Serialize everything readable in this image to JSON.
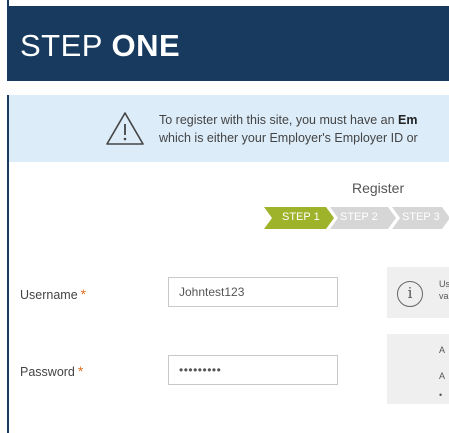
{
  "header": {
    "title_light": "STEP ",
    "title_bold": "ONE"
  },
  "banner": {
    "line1_prefix": "To register with this site, you must have an ",
    "line1_bold": "Em",
    "line2": "which is either your Employer's Employer ID or"
  },
  "register": {
    "title": "Register",
    "steps": [
      {
        "label": "STEP 1",
        "state": "active"
      },
      {
        "label": "STEP 2",
        "state": "inactive"
      },
      {
        "label": "STEP 3",
        "state": "inactive"
      }
    ],
    "active_color": "#9eb22a",
    "inactive_color": "#d6d6d6"
  },
  "form": {
    "username": {
      "label": "Username",
      "required_mark": "*",
      "value": "Johntest123"
    },
    "password": {
      "label": "Password",
      "required_mark": "*",
      "value": "•••••••••"
    }
  },
  "help": {
    "username_icon": "info-icon",
    "username_text_1": "Us",
    "username_text_2": "va",
    "password_text_1": "A",
    "password_text_2": "A",
    "password_text_3": "•"
  },
  "colors": {
    "header_bg": "#173a5e",
    "banner_bg": "#dcecf8",
    "required": "#e07020"
  }
}
